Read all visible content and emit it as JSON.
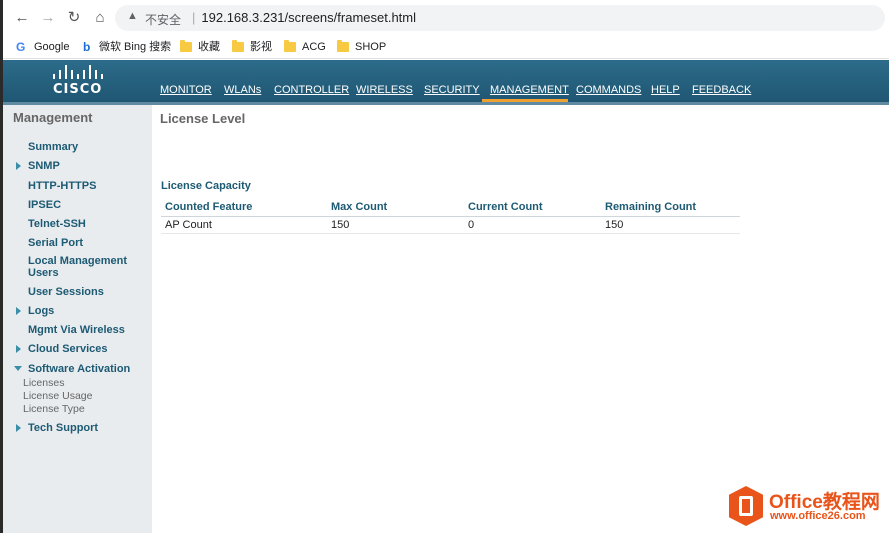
{
  "browser": {
    "insecure_label": "不安全",
    "url": "192.168.3.231/screens/frameset.html",
    "bookmarks": [
      {
        "label": "Google",
        "icon": "google-icon"
      },
      {
        "label": "微软 Bing 搜索",
        "icon": "bing-icon"
      },
      {
        "label": "收藏",
        "icon": "folder-icon"
      },
      {
        "label": "影视",
        "icon": "folder-icon"
      },
      {
        "label": "ACG",
        "icon": "folder-icon"
      },
      {
        "label": "SHOP",
        "icon": "folder-icon"
      }
    ]
  },
  "header": {
    "logo_text": "CISCO",
    "menu": [
      {
        "label": "MONITOR"
      },
      {
        "label": "WLANs"
      },
      {
        "label": "CONTROLLER"
      },
      {
        "label": "WIRELESS"
      },
      {
        "label": "SECURITY"
      },
      {
        "label": "MANAGEMENT",
        "active": true
      },
      {
        "label": "COMMANDS"
      },
      {
        "label": "HELP"
      },
      {
        "label": "FEEDBACK"
      }
    ],
    "accent_color": "#f0a030",
    "bar_color": "#1f5673"
  },
  "sidebar": {
    "title": "Management",
    "items": [
      {
        "label": "Summary"
      },
      {
        "label": "SNMP"
      },
      {
        "label": "HTTP-HTTPS"
      },
      {
        "label": "IPSEC"
      },
      {
        "label": "Telnet-SSH"
      },
      {
        "label": "Serial Port"
      },
      {
        "label": "Local Management"
      },
      {
        "label": "Users"
      },
      {
        "label": "User Sessions"
      },
      {
        "label": "Logs"
      },
      {
        "label": "Mgmt Via Wireless"
      },
      {
        "label": "Cloud Services"
      },
      {
        "label": "Software Activation"
      },
      {
        "label": "Tech Support"
      }
    ],
    "sub_items": [
      {
        "label": "Licenses"
      },
      {
        "label": "License Usage"
      },
      {
        "label": "License Type"
      }
    ]
  },
  "main": {
    "title": "License Level",
    "section_title": "License Capacity",
    "table": {
      "headers": [
        "Counted Feature",
        "Max Count",
        "Current Count",
        "Remaining Count"
      ],
      "rows": [
        [
          "AP Count",
          "150",
          "0",
          "150"
        ]
      ]
    }
  },
  "watermark": {
    "title": "Office教程网",
    "url": "www.office26.com"
  }
}
